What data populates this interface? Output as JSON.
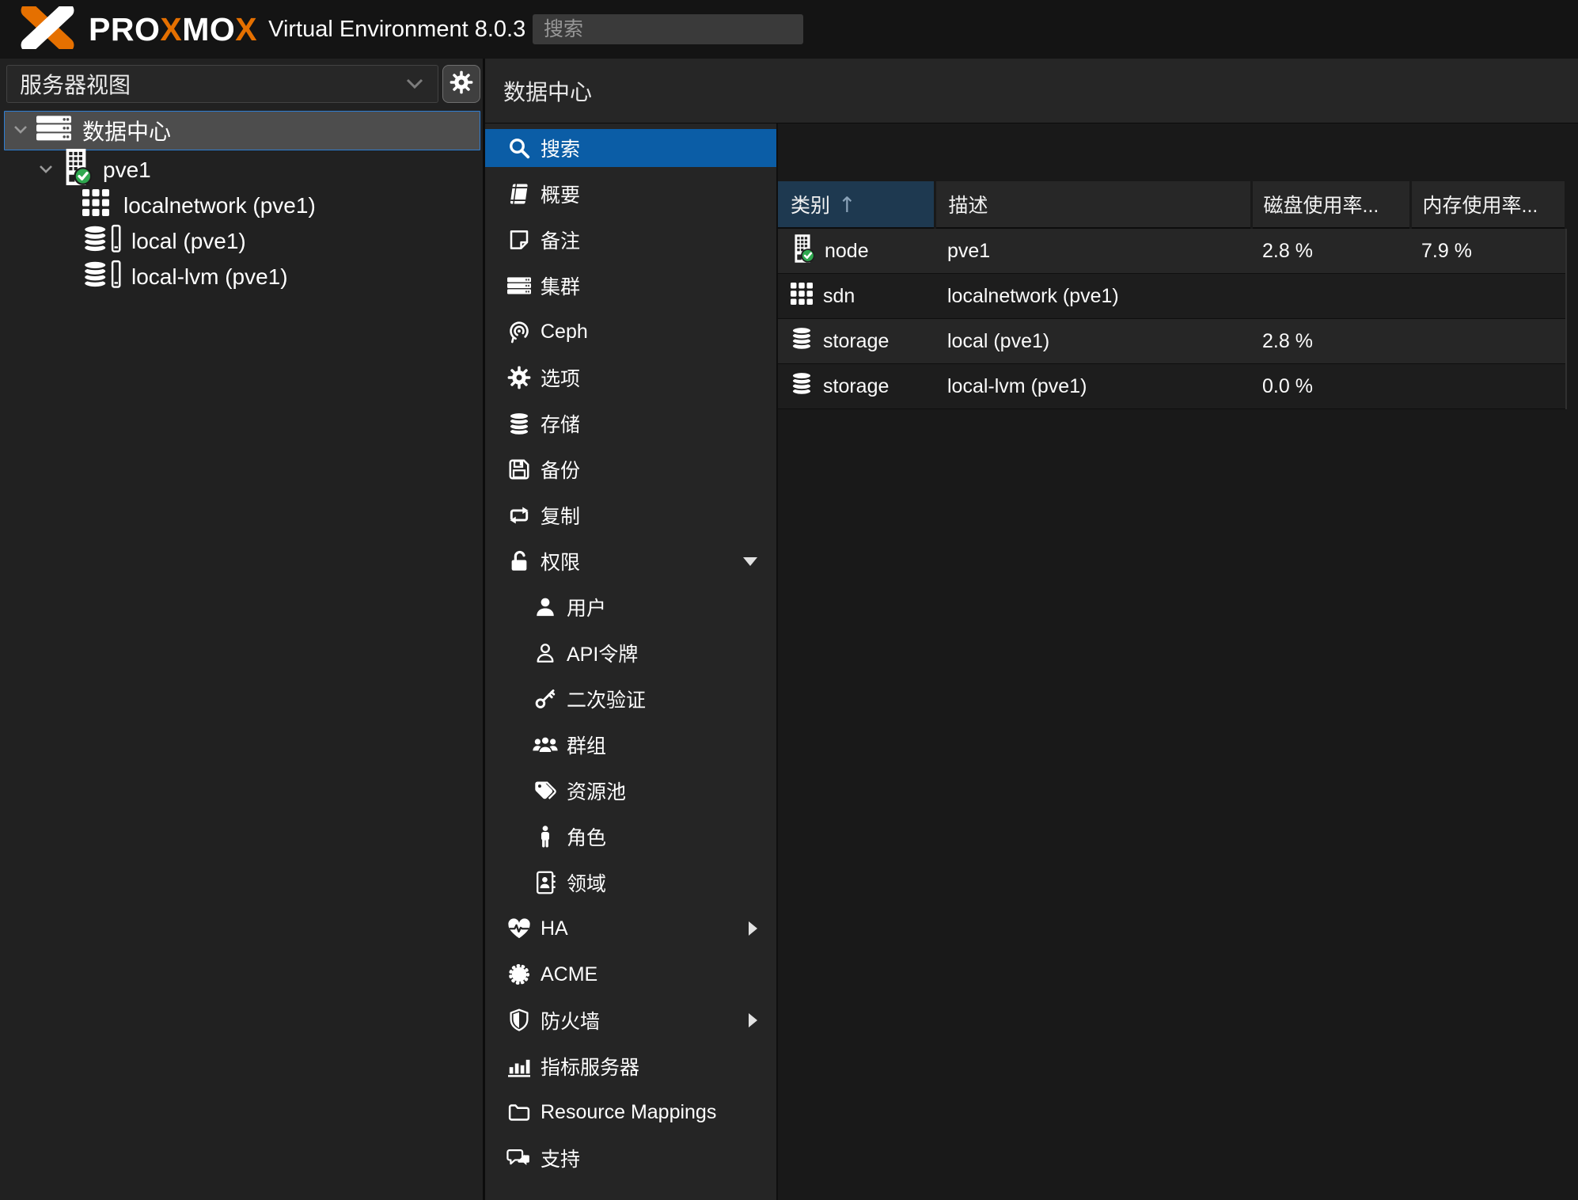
{
  "colors": {
    "accent_blue": "#0b5da6",
    "sorted_header": "#1e3950",
    "brand_orange": "#e57000",
    "ok_green": "#2fa84f",
    "tree_selection_border": "#2e7ed3"
  },
  "header": {
    "brand": {
      "seg1": "PRO",
      "x1": "X",
      "seg2": "MO",
      "x2": "X"
    },
    "version": "Virtual Environment 8.0.3",
    "search_placeholder": "搜索"
  },
  "sidebar": {
    "view_selector": {
      "value": "服务器视图",
      "icon": "chevron-down-icon"
    },
    "gear_button_icon": "gear-icon",
    "tree": {
      "items": [
        {
          "label": "数据中心",
          "icon": "server-icon",
          "selected": true
        },
        {
          "label": "pve1",
          "icon": "node-building-check-icon"
        },
        {
          "label": "localnetwork (pve1)",
          "icon": "sdn-grid-icon"
        },
        {
          "label": "local (pve1)",
          "icon": "storage-drive-icon"
        },
        {
          "label": "local-lvm (pve1)",
          "icon": "storage-drive-icon"
        }
      ]
    }
  },
  "content": {
    "title": "数据中心",
    "menu": {
      "selected": "搜索",
      "items": [
        {
          "label": "搜索",
          "icon": "search-icon"
        },
        {
          "label": "概要",
          "icon": "book-icon"
        },
        {
          "label": "备注",
          "icon": "note-icon"
        },
        {
          "label": "集群",
          "icon": "server-icon"
        },
        {
          "label": "Ceph",
          "icon": "ceph-icon"
        },
        {
          "label": "选项",
          "icon": "gear-icon"
        },
        {
          "label": "存储",
          "icon": "database-icon"
        },
        {
          "label": "备份",
          "icon": "floppy-icon"
        },
        {
          "label": "复制",
          "icon": "retweet-icon"
        },
        {
          "label": "权限",
          "icon": "unlock-icon",
          "expanded": true
        },
        {
          "label": "用户",
          "icon": "user-icon",
          "sub": true
        },
        {
          "label": "API令牌",
          "icon": "user-outline-icon",
          "sub": true
        },
        {
          "label": "二次验证",
          "icon": "key-icon",
          "sub": true
        },
        {
          "label": "群组",
          "icon": "users-icon",
          "sub": true
        },
        {
          "label": "资源池",
          "icon": "tags-icon",
          "sub": true
        },
        {
          "label": "角色",
          "icon": "person-icon",
          "sub": true
        },
        {
          "label": "领域",
          "icon": "address-book-icon",
          "sub": true
        },
        {
          "label": "HA",
          "icon": "heartbeat-icon",
          "has_submenu": true
        },
        {
          "label": "ACME",
          "icon": "seal-icon"
        },
        {
          "label": "防火墙",
          "icon": "shield-icon",
          "has_submenu": true
        },
        {
          "label": "指标服务器",
          "icon": "bar-chart-icon"
        },
        {
          "label": "Resource Mappings",
          "icon": "folder-icon"
        },
        {
          "label": "支持",
          "icon": "comments-icon"
        }
      ]
    },
    "table": {
      "sort_indicator": "↑",
      "columns": [
        {
          "label": "类别",
          "sorted": true
        },
        {
          "label": "描述"
        },
        {
          "label": "磁盘使用率..."
        },
        {
          "label": "内存使用率..."
        }
      ],
      "rows": [
        {
          "type": "node",
          "icon": "node-building-check-icon",
          "desc": "pve1",
          "disk": "2.8 %",
          "mem": "7.9 %"
        },
        {
          "type": "sdn",
          "icon": "sdn-grid-icon",
          "desc": "localnetwork (pve1)",
          "disk": "",
          "mem": ""
        },
        {
          "type": "storage",
          "icon": "database-icon",
          "desc": "local (pve1)",
          "disk": "2.8 %",
          "mem": ""
        },
        {
          "type": "storage",
          "icon": "database-icon",
          "desc": "local-lvm (pve1)",
          "disk": "0.0 %",
          "mem": ""
        }
      ]
    }
  }
}
